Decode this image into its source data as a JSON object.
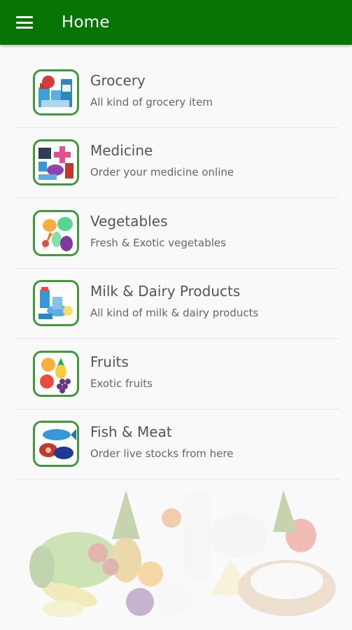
{
  "appbar": {
    "title": "Home",
    "color": "#067503",
    "menu_icon": "hamburger-menu-icon"
  },
  "categories": [
    {
      "title": "Grocery",
      "subtitle": "All kind of grocery item",
      "icon": "grocery-icon"
    },
    {
      "title": "Medicine",
      "subtitle": "Order your medicine online",
      "icon": "medicine-icon"
    },
    {
      "title": "Vegetables",
      "subtitle": "Fresh & Exotic vegetables",
      "icon": "vegetables-icon"
    },
    {
      "title": "Milk & Dairy Products",
      "subtitle": "All kind of milk & dairy products",
      "icon": "dairy-icon"
    },
    {
      "title": "Fruits",
      "subtitle": "Exotic fruits",
      "icon": "fruits-icon"
    },
    {
      "title": "Fish & Meat",
      "subtitle": "Order live stocks from here",
      "icon": "fish-meat-icon"
    }
  ],
  "colors": {
    "thumb_border": "#3f9a3c",
    "background": "#f9f9f9"
  },
  "background_art": "faded-fresh-produce-illustration"
}
